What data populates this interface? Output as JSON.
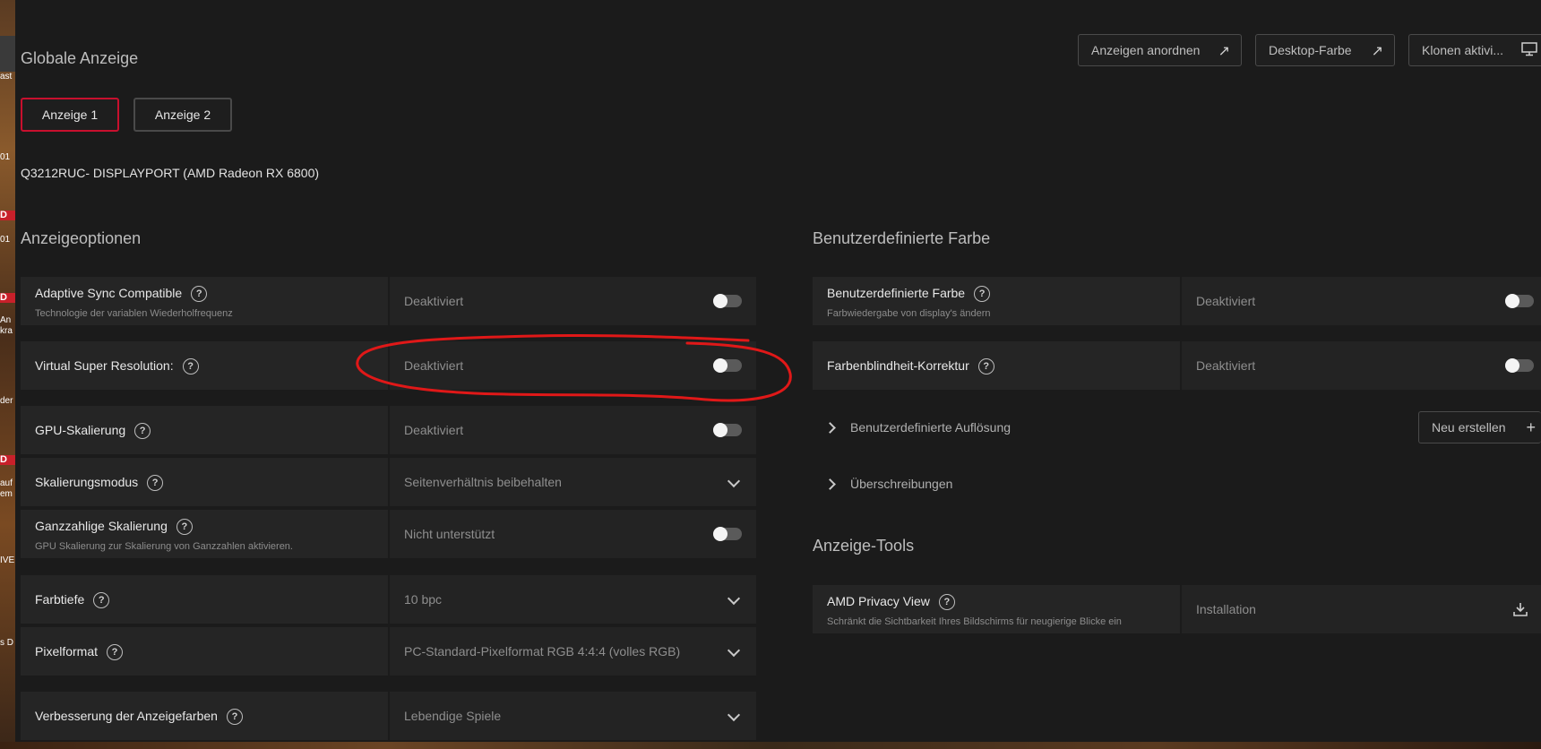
{
  "header": {
    "title": "Globale Anzeige",
    "buttons": [
      {
        "label": "Anzeigen anordnen",
        "icon": "external-arrow-icon"
      },
      {
        "label": "Desktop-Farbe",
        "icon": "external-arrow-icon"
      },
      {
        "label": "Klonen aktivi...",
        "icon": "monitor-icon"
      }
    ]
  },
  "display_tabs": [
    {
      "label": "Anzeige 1",
      "selected": true
    },
    {
      "label": "Anzeige 2",
      "selected": false
    }
  ],
  "monitor_name": "Q3212RUC- DISPLAYPORT (AMD Radeon RX 6800)",
  "display_options": {
    "title": "Anzeigeoptionen",
    "rows": [
      {
        "label": "Adaptive Sync Compatible",
        "sub": "Technologie der variablen Wiederholfrequenz",
        "value": "Deaktiviert",
        "control": "toggle",
        "on": false
      },
      {
        "label": "Virtual Super Resolution:",
        "sub": "",
        "value": "Deaktiviert",
        "control": "toggle",
        "on": false
      },
      {
        "label": "GPU-Skalierung",
        "sub": "",
        "value": "Deaktiviert",
        "control": "toggle",
        "on": false
      },
      {
        "label": "Skalierungsmodus",
        "sub": "",
        "value": "Seitenverhältnis beibehalten",
        "control": "dropdown"
      },
      {
        "label": "Ganzzahlige Skalierung",
        "sub": "GPU Skalierung zur Skalierung von Ganzzahlen aktivieren.",
        "value": "Nicht unterstützt",
        "control": "toggle",
        "on": false
      },
      {
        "label": "Farbtiefe",
        "sub": "",
        "value": "10 bpc",
        "control": "dropdown"
      },
      {
        "label": "Pixelformat",
        "sub": "",
        "value": "PC-Standard-Pixelformat RGB 4:4:4 (volles RGB)",
        "control": "dropdown"
      },
      {
        "label": "Verbesserung der Anzeigefarben",
        "sub": "",
        "value": "Lebendige Spiele",
        "control": "dropdown"
      }
    ]
  },
  "custom_color": {
    "title": "Benutzerdefinierte Farbe",
    "rows": [
      {
        "label": "Benutzerdefinierte Farbe",
        "sub": "Farbwiedergabe von display's ändern",
        "value": "Deaktiviert",
        "control": "toggle",
        "on": false
      },
      {
        "label": "Farbenblindheit-Korrektur",
        "sub": "",
        "value": "Deaktiviert",
        "control": "toggle",
        "on": false
      }
    ],
    "custom_resolution": "Benutzerdefinierte Auflösung",
    "new_button": "Neu erstellen",
    "overrides": "Überschreibungen"
  },
  "display_tools": {
    "title": "Anzeige-Tools",
    "row": {
      "label": "AMD Privacy View",
      "sub": "Schränkt die Sichtbarkeit Ihres Bildschirms für neugierige Blicke ein",
      "value": "Installation",
      "icon": "download-icon"
    }
  },
  "desktop_fragments": [
    "ast",
    "01",
    "D",
    "01",
    "D",
    "An",
    "kra",
    "der",
    "D",
    "auf",
    "em",
    "IVE",
    "s D"
  ],
  "colors": {
    "accent": "#c8102e",
    "annotation": "#e01818"
  }
}
